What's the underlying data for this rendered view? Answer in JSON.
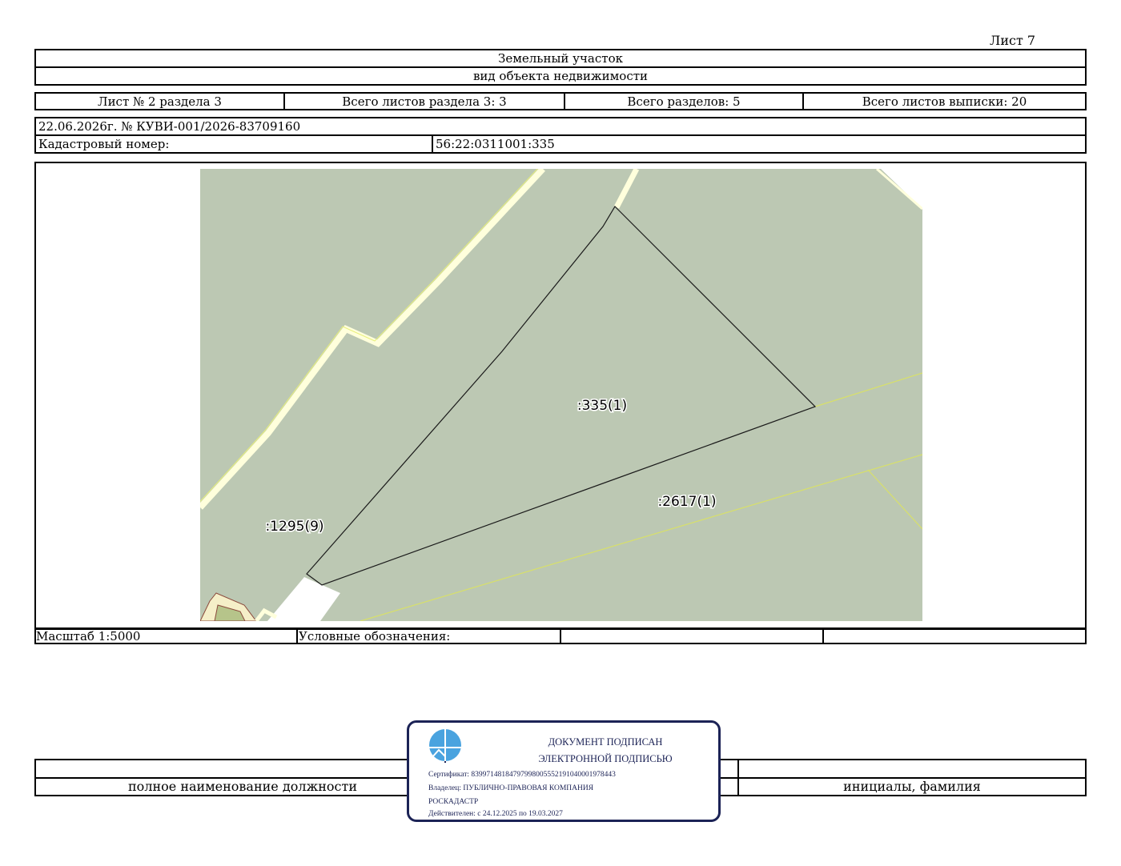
{
  "sheet_label": "Лист 7",
  "header": {
    "object_type": "Земельный участок",
    "object_type_caption": "вид объекта недвижимости"
  },
  "sheets_info": {
    "sheet_of_section": "Лист № 2 раздела 3",
    "total_section_sheets": "Всего листов раздела 3: 3",
    "total_sections": "Всего разделов: 5",
    "total_extract_sheets": "Всего листов выписки: 20"
  },
  "document": {
    "date_number": "22.06.2026г. № КУВИ-001/2026-83709160",
    "cadastral_label": "Кадастровый номер:",
    "cadastral_number": "56:22:0311001:335"
  },
  "map": {
    "labels": {
      "parcel_main": ":335(1)",
      "parcel_road": ":2617(1)",
      "parcel_left": ":1295(9)"
    },
    "colors": {
      "land_fill": "#bcc8b3",
      "boundary": "#000000",
      "road_edge": "#ffffdc",
      "road_outline": "#e8f07a",
      "building": "#8b4a3c"
    }
  },
  "legend": {
    "scale": "Масштаб 1:5000",
    "legend_label": "Условные обозначения:"
  },
  "signature": {
    "position_caption": "полное наименование должности",
    "name_caption": "инициалы, фамилия"
  },
  "stamp": {
    "title_line1": "ДОКУМЕНТ ПОДПИСАН",
    "title_line2": "ЭЛЕКТРОННОЙ ПОДПИСЬЮ",
    "certificate": "Сертификат: 83997148184797998005552191040001978443",
    "owner_line1": "Владелец: ПУБЛИЧНО-ПРАВОВАЯ КОМПАНИЯ",
    "owner_line2": "РОСКАДАСТР",
    "validity": "Действителен: с 24.12.2025 по 19.03.2027"
  }
}
